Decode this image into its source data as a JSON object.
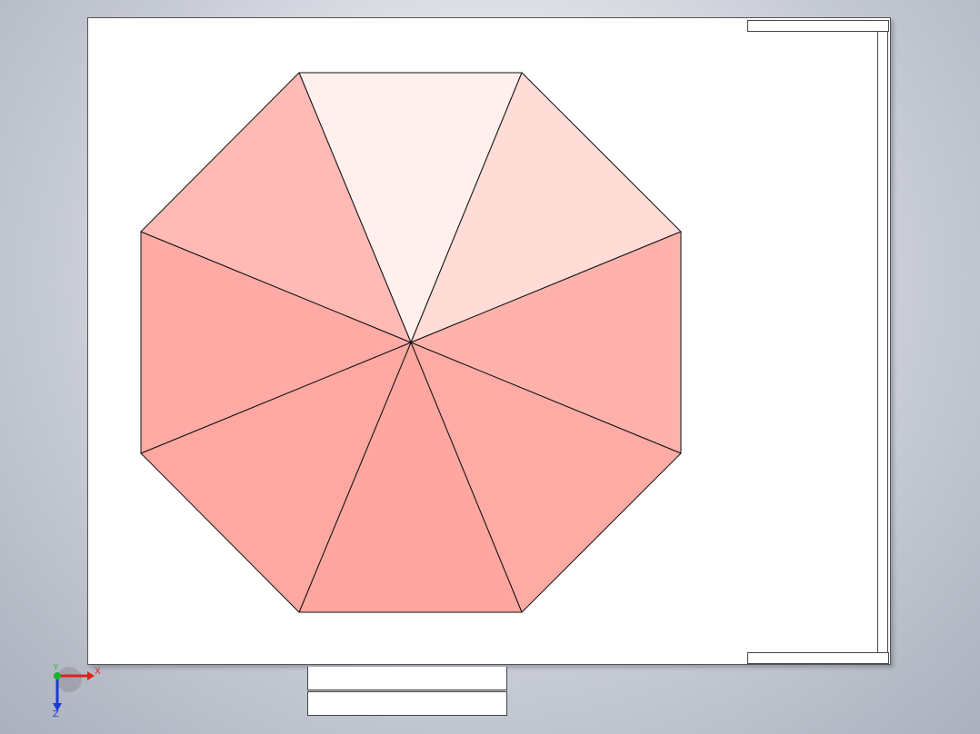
{
  "model": {
    "face_colors": [
      "#fff0ed",
      "#ffdcd6",
      "#ffb2ab",
      "#ffaba5",
      "#ffa6a0",
      "#ffa7a1",
      "#ffaaa4",
      "#ffbab5"
    ],
    "edge_color": "#111111",
    "sheet_background": "#ffffff"
  },
  "triad": {
    "x_label": "X",
    "y_label": "Y",
    "z_label": "Z",
    "x_color": "#e0201a",
    "y_color": "#18b52a",
    "z_color": "#1a3ad8"
  }
}
